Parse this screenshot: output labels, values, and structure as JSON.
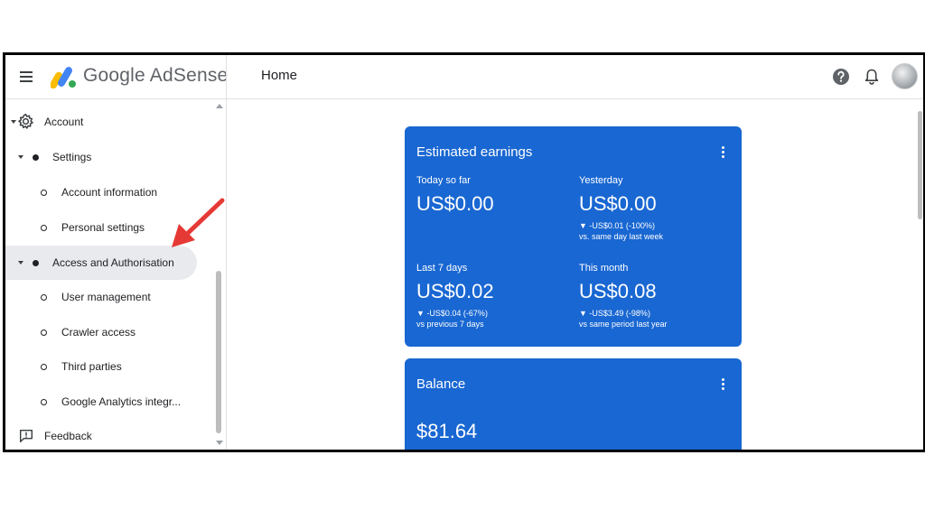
{
  "header": {
    "brand": "Google AdSense",
    "page_title": "Home"
  },
  "sidebar": {
    "account_label": "Account",
    "settings_label": "Settings",
    "account_information_label": "Account information",
    "personal_settings_label": "Personal settings",
    "access_label": "Access and Authorisation",
    "user_management_label": "User management",
    "crawler_access_label": "Crawler access",
    "third_parties_label": "Third parties",
    "google_analytics_label": "Google Analytics integr...",
    "feedback_label": "Feedback"
  },
  "earnings": {
    "title": "Estimated earnings",
    "today_label": "Today so far",
    "today_value": "US$0.00",
    "yesterday_label": "Yesterday",
    "yesterday_value": "US$0.00",
    "yesterday_change": "▼ -US$0.01 (-100%)",
    "yesterday_compare": "vs. same day last week",
    "last7_label": "Last 7 days",
    "last7_value": "US$0.02",
    "last7_change": "▼ -US$0.04 (-67%)",
    "last7_compare": "vs previous 7 days",
    "month_label": "This month",
    "month_value": "US$0.08",
    "month_change": "▼ -US$3.49 (-98%)",
    "month_compare": "vs same period last year"
  },
  "balance": {
    "title": "Balance",
    "value": "$81.64"
  },
  "colors": {
    "card_blue": "#1967d2",
    "active_nav": "#e8eaed",
    "annotation_arrow": "#e53935"
  },
  "icons": {
    "menu": "hamburger-icon",
    "help": "help-icon",
    "notifications": "bell-icon",
    "account": "gear-icon",
    "feedback": "feedback-icon",
    "card_menu": "more-vert-icon"
  }
}
